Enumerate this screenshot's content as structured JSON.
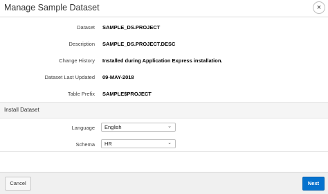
{
  "dialog": {
    "title": "Manage Sample Dataset",
    "close_label": "×"
  },
  "details": [
    {
      "label": "Dataset",
      "value": "SAMPLE_DS.PROJECT"
    },
    {
      "label": "Description",
      "value": "SAMPLE_DS.PROJECT.DESC"
    },
    {
      "label": "Change History",
      "value": "Installed during Application Express installation."
    },
    {
      "label": "Dataset Last Updated",
      "value": "09-MAY-2018"
    },
    {
      "label": "Table Prefix",
      "value": "SAMPLE$PROJECT"
    }
  ],
  "install": {
    "section_title": "Install Dataset",
    "language": {
      "label": "Language",
      "value": "English"
    },
    "schema": {
      "label": "Schema",
      "value": "HR"
    },
    "chevron": "⌄"
  },
  "footer": {
    "cancel_label": "Cancel",
    "next_label": "Next"
  }
}
